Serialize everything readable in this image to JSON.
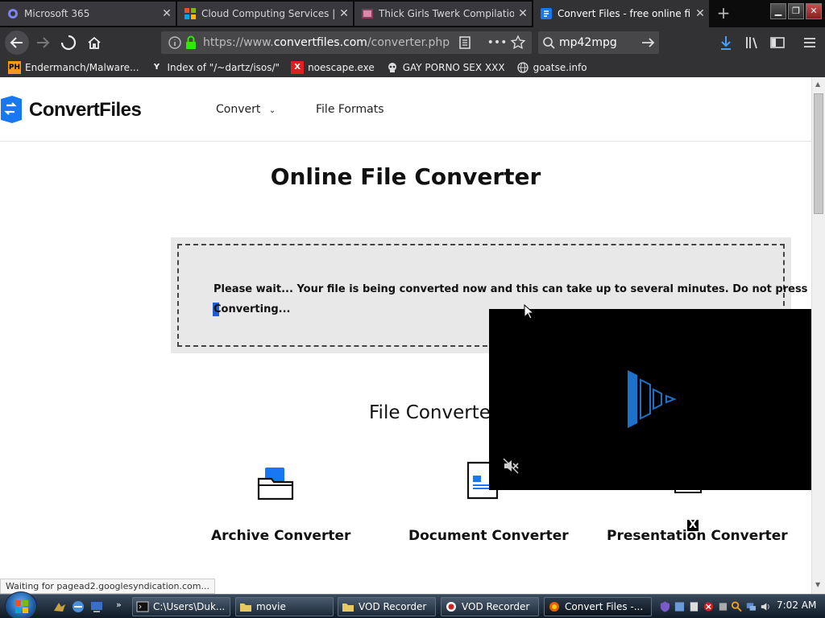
{
  "browser": {
    "tabs": [
      {
        "title": "Microsoft 365",
        "icon": "microsoft-365-icon"
      },
      {
        "title": "Cloud Computing Services | M",
        "icon": "windows-logo-icon"
      },
      {
        "title": "Thick Girls Twerk Compilation",
        "icon": "video-site-icon"
      },
      {
        "title": "Convert Files - free online file c",
        "icon": "convertfiles-icon",
        "active": true
      }
    ],
    "url_prefix": "https://www.",
    "url_domain": "convertfiles.com",
    "url_path": "/converter.php",
    "search_value": "mp42mpg",
    "bookmarks": [
      {
        "label": "Endermanch/Malware...",
        "icon": "PH"
      },
      {
        "label": "Index of \"/~dartz/isos/\"",
        "icon": "Y"
      },
      {
        "label": "noescape.exe",
        "icon": "X"
      },
      {
        "label": "GAY PORNO SEX XXX",
        "icon": "skull-icon"
      },
      {
        "label": "goatse.info",
        "icon": "globe-icon"
      }
    ]
  },
  "site": {
    "logo": "ConvertFiles",
    "nav": {
      "convert": "Convert",
      "formats": "File Formats"
    },
    "title": "Online File Converter",
    "wait_message": "Please wait... Your file is being converted now and this can take up to several minutes. Do not press refresh.",
    "converting": "Converting...",
    "section_title": "File Converter",
    "converters": [
      "Archive Converter",
      "Document Converter",
      "Presentation Converter"
    ],
    "accent": "#1877f2"
  },
  "ad": {
    "close": "X"
  },
  "status": "Waiting for pagead2.googlesyndication.com...",
  "taskbar": {
    "tasks": [
      "C:\\Users\\Duk...",
      "movie",
      "VOD Recorder",
      "VOD Recorder",
      "Convert Files -..."
    ],
    "clock": "7:02 AM"
  }
}
